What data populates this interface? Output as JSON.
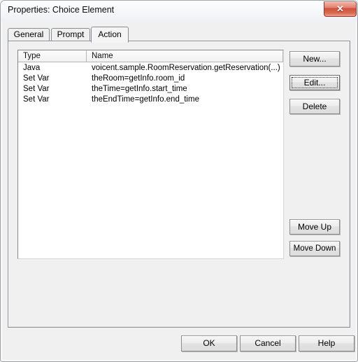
{
  "window": {
    "title": "Properties: Choice Element",
    "close_glyph": "✕"
  },
  "tabs": [
    {
      "label": "General",
      "selected": false
    },
    {
      "label": "Prompt",
      "selected": false
    },
    {
      "label": "Action",
      "selected": true
    }
  ],
  "listview": {
    "columns": [
      "Type",
      "Name"
    ],
    "rows": [
      {
        "type": "Java",
        "name": "voicent.sample.RoomReservation.getReservation(...)"
      },
      {
        "type": "Set Var",
        "name": "theRoom=getInfo.room_id"
      },
      {
        "type": "Set Var",
        "name": "theTime=getInfo.start_time"
      },
      {
        "type": "Set Var",
        "name": "theEndTime=getInfo.end_time"
      }
    ]
  },
  "side_buttons": {
    "new": "New...",
    "edit": "Edit...",
    "delete": "Delete",
    "move_up": "Move Up",
    "move_down": "Move Down"
  },
  "bottom_buttons": {
    "ok": "OK",
    "cancel": "Cancel",
    "help": "Help"
  },
  "colors": {
    "window_bg": "#f0f0f0",
    "panel_bg": "#f5f5f5",
    "list_bg": "#ffffff",
    "close_red": "#ce4f39",
    "border": "#8e9199"
  }
}
